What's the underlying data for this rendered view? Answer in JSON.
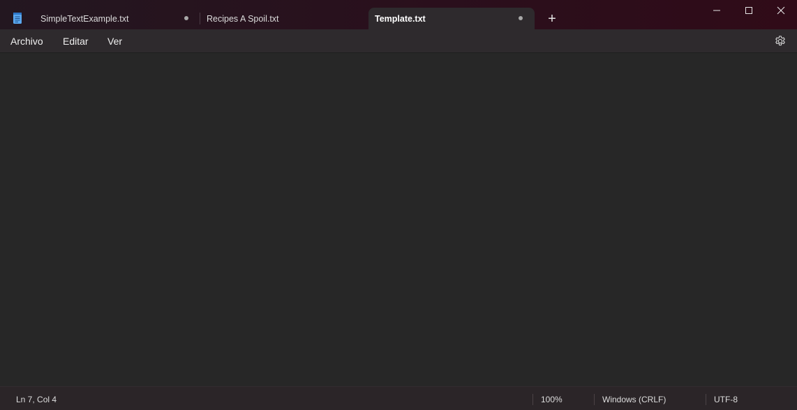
{
  "app": {
    "icon": "notepad-icon"
  },
  "tabs": [
    {
      "label": "SimpleTextExample.txt",
      "modified": true,
      "active": false
    },
    {
      "label": "Recipes A Spoil.txt",
      "modified": false,
      "active": false
    },
    {
      "label": "Template.txt",
      "modified": true,
      "active": true
    }
  ],
  "tabbar": {
    "new_tab_symbol": "+"
  },
  "menu": {
    "items": [
      "Archivo",
      "Editar",
      "Ver"
    ],
    "settings_icon": "gear-icon"
  },
  "editor": {
    "content": ""
  },
  "status": {
    "position": "Ln 7, Col 4",
    "zoom": "100%",
    "line_ending": "Windows (CRLF)",
    "encoding": "UTF-8"
  },
  "colors": {
    "editor_bg": "#272727",
    "titlebar_accent": "#300b18",
    "app_icon": "#4a9be8"
  }
}
